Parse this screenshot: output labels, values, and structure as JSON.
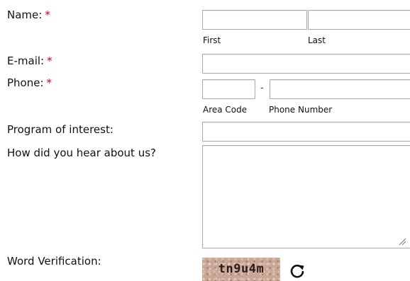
{
  "form": {
    "name": {
      "label": "Name:",
      "required_marker": "*",
      "first_value": "",
      "last_value": "",
      "first_caption": "First",
      "last_caption": "Last"
    },
    "email": {
      "label": "E-mail:",
      "required_marker": "*",
      "value": ""
    },
    "phone": {
      "label": "Phone:",
      "required_marker": "*",
      "area_value": "",
      "number_value": "",
      "separator": "-",
      "area_caption": "Area Code",
      "number_caption": "Phone Number"
    },
    "program": {
      "label": "Program of interest:",
      "value": ""
    },
    "heard": {
      "label": "How did you hear about us?",
      "value": ""
    },
    "verification": {
      "label": "Word Verification:",
      "captcha_text": "tn9u4m",
      "refresh_icon": "refresh-icon"
    }
  },
  "colors": {
    "required": "#d0021b",
    "input_border": "#a9a9a9",
    "captcha_bg": "#c9a795"
  }
}
